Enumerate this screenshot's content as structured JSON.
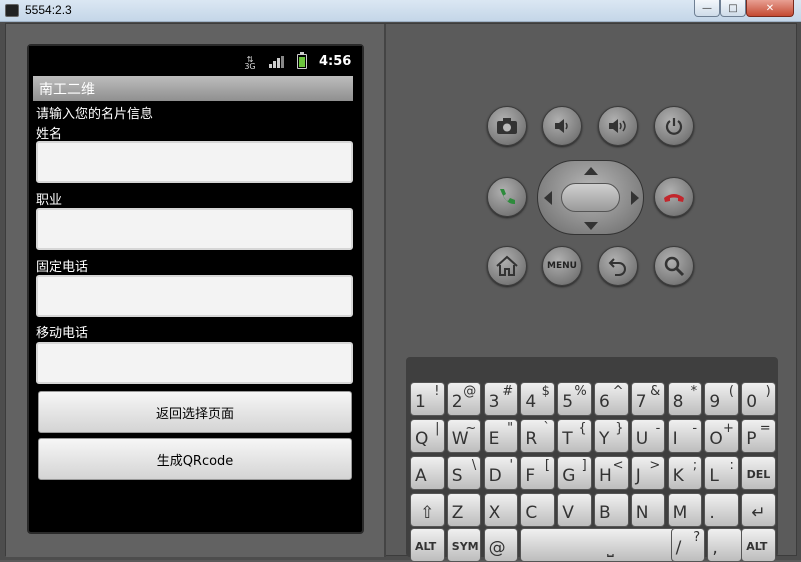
{
  "window": {
    "title": "5554:2.3",
    "min_label": "—",
    "max_label": "□",
    "close_label": "✕"
  },
  "status": {
    "network": "3G",
    "time": "4:56"
  },
  "app": {
    "title": "南工二维",
    "intro": "请输入您的名片信息",
    "fields": [
      {
        "label": "姓名",
        "value": ""
      },
      {
        "label": "职业",
        "value": ""
      },
      {
        "label": "固定电话",
        "value": ""
      },
      {
        "label": "移动电话",
        "value": ""
      }
    ],
    "back_button": "返回选择页面",
    "generate_button": "生成QRcode"
  },
  "hardware": {
    "camera": "camera-icon",
    "vol_down": "volume-down-icon",
    "vol_up": "volume-up-icon",
    "power": "power-icon",
    "call": "call-icon",
    "end_call": "end-call-icon",
    "home": "home-icon",
    "menu_label": "MENU",
    "back": "back-icon",
    "search": "search-icon"
  },
  "keyboard": {
    "row1": [
      [
        "1",
        "!"
      ],
      [
        "2",
        "@"
      ],
      [
        "3",
        "#"
      ],
      [
        "4",
        "$"
      ],
      [
        "5",
        "%"
      ],
      [
        "6",
        "^"
      ],
      [
        "7",
        "&"
      ],
      [
        "8",
        "*"
      ],
      [
        "9",
        "("
      ],
      [
        "0",
        ")"
      ]
    ],
    "row2": [
      [
        "Q",
        "|"
      ],
      [
        "W",
        "~"
      ],
      [
        "E",
        "\""
      ],
      [
        "R",
        "`"
      ],
      [
        "T",
        "{"
      ],
      [
        "Y",
        "}"
      ],
      [
        "U",
        "-"
      ],
      [
        "I",
        "-"
      ],
      [
        "O",
        "+"
      ],
      [
        "P",
        "="
      ]
    ],
    "row3": [
      [
        "A",
        ""
      ],
      [
        "S",
        "\\"
      ],
      [
        "D",
        "'"
      ],
      [
        "F",
        "["
      ],
      [
        "G",
        "]"
      ],
      [
        "H",
        "<"
      ],
      [
        "J",
        ">"
      ],
      [
        "K",
        ";"
      ],
      [
        "L",
        ":"
      ],
      [
        "DEL",
        ""
      ]
    ],
    "row4": [
      [
        "⇧",
        ""
      ],
      [
        "Z",
        ""
      ],
      [
        "X",
        ""
      ],
      [
        "C",
        ""
      ],
      [
        "V",
        ""
      ],
      [
        "B",
        ""
      ],
      [
        "N",
        ""
      ],
      [
        "M",
        ""
      ],
      [
        ".",
        ""
      ],
      [
        "↵",
        ""
      ]
    ],
    "row5": [
      [
        "ALT",
        ""
      ],
      [
        "SYM",
        ""
      ],
      [
        "@",
        ""
      ],
      [
        "⎵",
        ""
      ],
      [
        "/",
        "?"
      ],
      [
        ",",
        ""
      ],
      [
        "ALT",
        ""
      ]
    ]
  },
  "colors": {
    "call_green": "#2e8b3c",
    "end_red": "#c2262c",
    "battery": "#6bc43c"
  }
}
